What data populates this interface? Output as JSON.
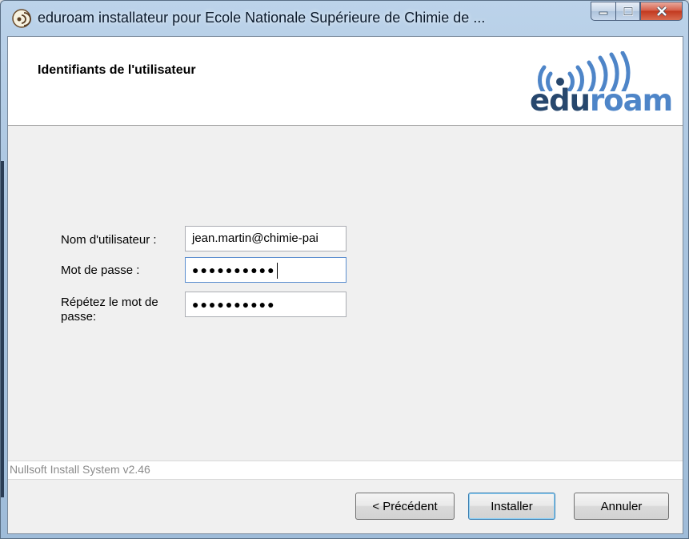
{
  "window": {
    "title": "eduroam installateur pour Ecole Nationale Supérieure de Chimie de ..."
  },
  "header": {
    "title": "Identifiants de l'utilisateur",
    "logo": {
      "prefix": "ed",
      "u": "u",
      "suffix": "roam",
      "colors": {
        "dark": "#27476d",
        "light": "#4e85c8"
      }
    }
  },
  "form": {
    "username_label": "Nom d'utilisateur :",
    "username_value": "jean.martin@chimie-pai",
    "password_label": "Mot de passe :",
    "password_value": "●●●●●●●●●●",
    "repeat_label_line1": "Répétez le mot de",
    "repeat_label_line2": "passe:",
    "repeat_value": "●●●●●●●●●●"
  },
  "branding": "Nullsoft Install System v2.46",
  "buttons": {
    "previous": "< Précédent",
    "install": "Installer",
    "cancel": "Annuler"
  }
}
